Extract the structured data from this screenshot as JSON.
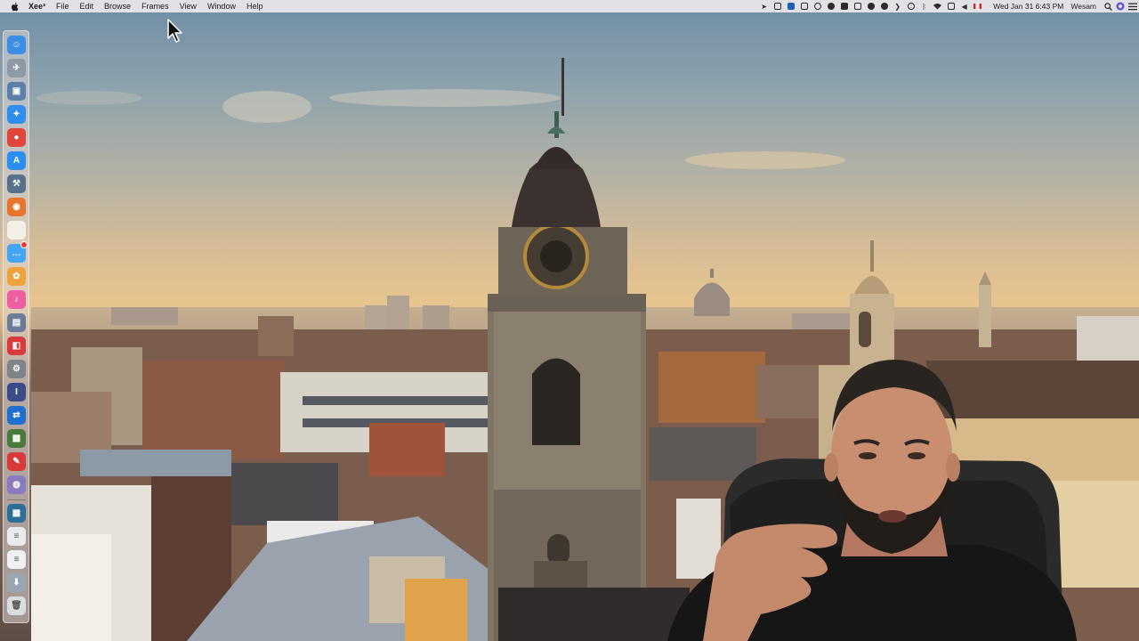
{
  "menubar": {
    "app_name": "Xee³",
    "menus": [
      "File",
      "Edit",
      "Browse",
      "Frames",
      "View",
      "Window",
      "Help"
    ],
    "clock": "Wed Jan 31  6:43 PM",
    "user": "Wesam",
    "tray_icons": [
      "location-icon",
      "screen-record-icon",
      "dropbox-icon",
      "vpn-icon",
      "onepassword-icon",
      "cloud-icon",
      "folder-icon",
      "bartender-icon",
      "cleanmaster-icon",
      "alfred-icon",
      "chevron-icon",
      "time-machine-icon",
      "bluetooth-icon",
      "wifi-icon",
      "airplay-icon",
      "volume-icon",
      "flag-canada-icon"
    ]
  },
  "dock": {
    "items": [
      {
        "name": "finder",
        "color": "#3a8ee6",
        "glyph": "☺"
      },
      {
        "name": "launchpad",
        "color": "#8e9aa8",
        "glyph": "✈"
      },
      {
        "name": "preview",
        "color": "#5c7fa8",
        "glyph": "▣"
      },
      {
        "name": "safari",
        "color": "#2f8ef0",
        "glyph": "✦"
      },
      {
        "name": "chrome",
        "color": "#e0463a",
        "glyph": "●"
      },
      {
        "name": "app-store",
        "color": "#2a8ff0",
        "glyph": "A"
      },
      {
        "name": "xcode",
        "color": "#58708a",
        "glyph": "⚒"
      },
      {
        "name": "firefox",
        "color": "#e8752c",
        "glyph": "◉"
      },
      {
        "name": "notes",
        "color": "#f2f0e6",
        "glyph": " "
      },
      {
        "name": "messages",
        "color": "#43a5f5",
        "glyph": "…",
        "badge": true
      },
      {
        "name": "photos",
        "color": "#f0a33a",
        "glyph": "✿"
      },
      {
        "name": "itunes",
        "color": "#ee5ea3",
        "glyph": "♪"
      },
      {
        "name": "image-capture",
        "color": "#6a7c98",
        "glyph": "▤"
      },
      {
        "name": "photo-booth",
        "color": "#d93a3a",
        "glyph": "◧"
      },
      {
        "name": "system-preferences",
        "color": "#7e8489",
        "glyph": "⚙"
      },
      {
        "name": "instruments",
        "color": "#3c4a8a",
        "glyph": "I"
      },
      {
        "name": "teamviewer",
        "color": "#1f6fd1",
        "glyph": "⇄"
      },
      {
        "name": "image-editor",
        "color": "#4a7a3a",
        "glyph": "▩"
      },
      {
        "name": "pdf-expert",
        "color": "#d83a3a",
        "glyph": "✎"
      },
      {
        "name": "color-picker",
        "color": "#8a7ac0",
        "glyph": "◍"
      },
      {
        "name": "document-1",
        "color": "#2c6f96",
        "glyph": "▦"
      },
      {
        "name": "document-2",
        "color": "#e9ecef",
        "glyph": "≡"
      },
      {
        "name": "document-3",
        "color": "#eef0f2",
        "glyph": "≡"
      },
      {
        "name": "downloads-folder",
        "color": "#9aa6b2",
        "glyph": "⬇"
      },
      {
        "name": "trash",
        "color": "#d9dde0",
        "glyph": "🗑"
      }
    ]
  }
}
